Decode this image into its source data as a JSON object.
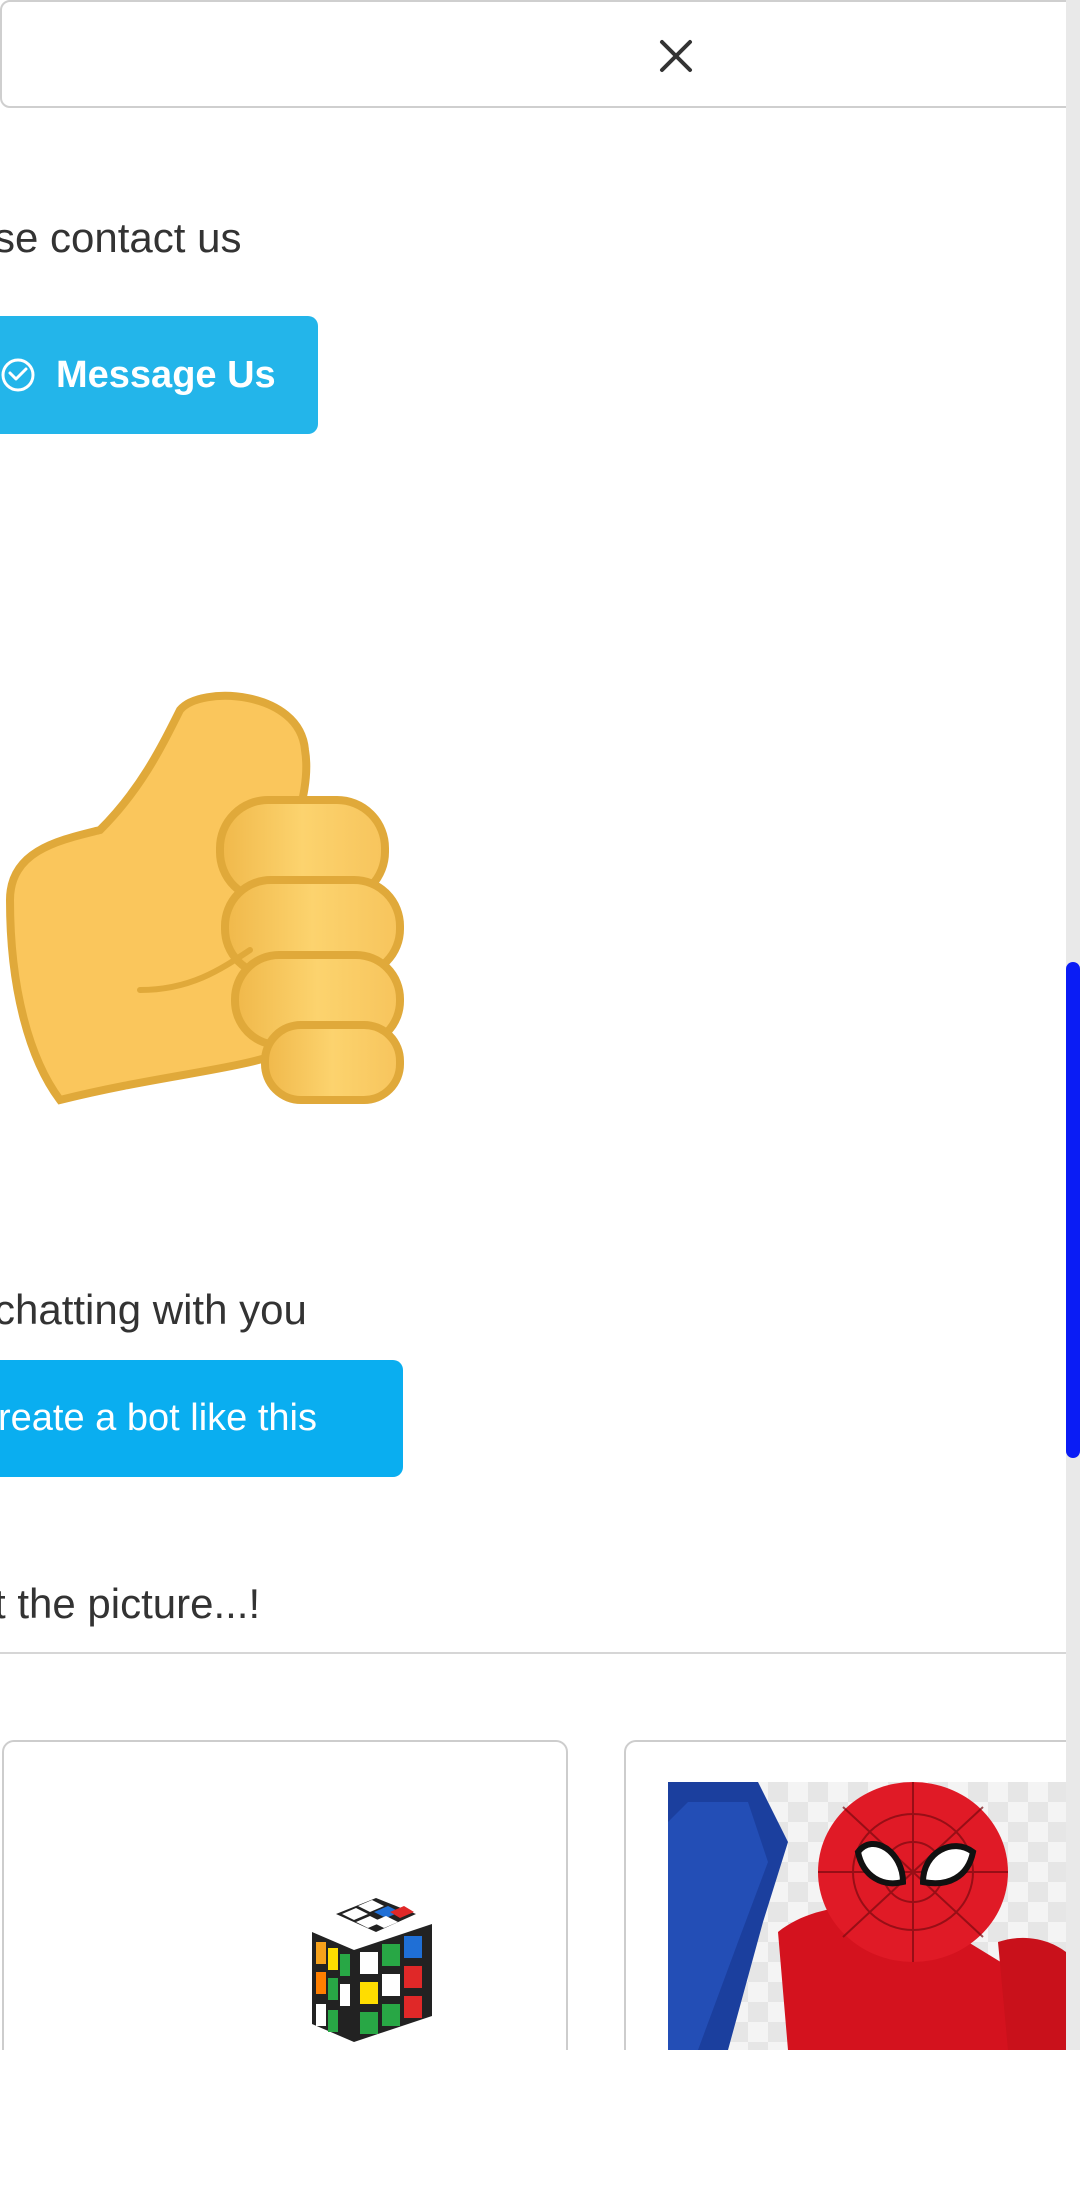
{
  "top_bar": {
    "close_icon": "close-icon"
  },
  "contact_section": {
    "text": "se contact us",
    "message_button": {
      "label": "Message Us",
      "icon": "messenger-icon"
    }
  },
  "emoji": {
    "icon": "thumbs-up-icon"
  },
  "bot_section": {
    "text": "chatting with you",
    "create_button_label": "reate a bot like this"
  },
  "picture_prompt": "t the picture...!",
  "cards": [
    {
      "image": "rubiks-cube-image"
    },
    {
      "image": "spiderman-image"
    }
  ],
  "colors": {
    "message_button": "#23b5ea",
    "create_button": "#0aaef0",
    "scrollbar_thumb": "#0a1cf5",
    "thumb_fill": "#f9c65a",
    "thumb_outline": "#e0a93a"
  }
}
